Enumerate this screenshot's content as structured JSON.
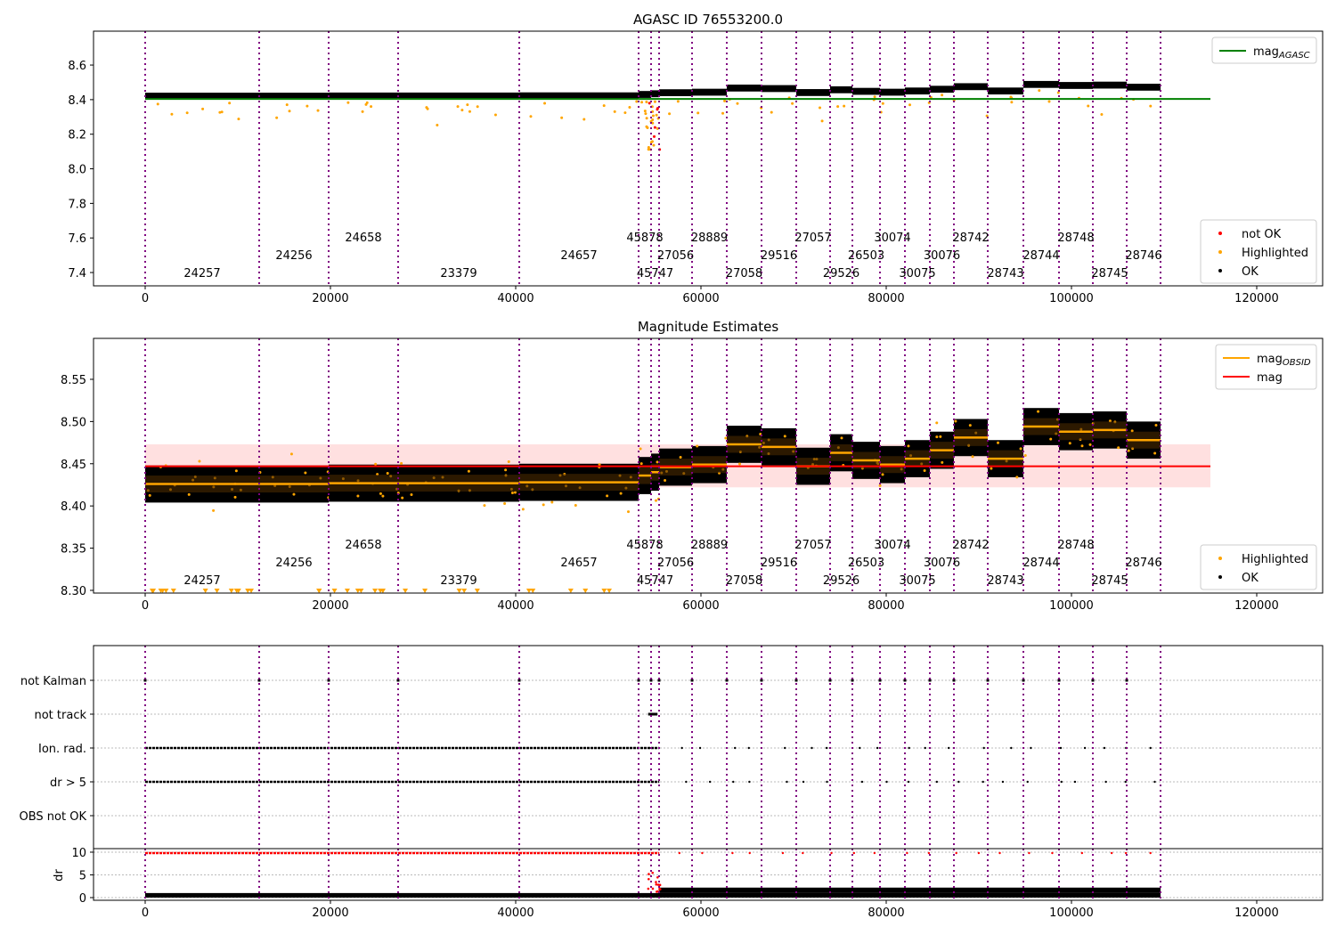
{
  "chart_data": [
    {
      "type": "scatter",
      "title": "AGASC ID 76553200.0",
      "xlim": [
        -5577,
        127115
      ],
      "ylim": [
        7.323,
        8.796
      ],
      "xticks": [
        0,
        20000,
        40000,
        60000,
        80000,
        100000,
        120000
      ],
      "yticks": [
        7.4,
        7.6,
        7.8,
        8.0,
        8.2,
        8.4,
        8.6
      ],
      "legend_upper": [
        {
          "label": "mag",
          "sub": "AGASC",
          "color": "#008000",
          "kind": "line"
        }
      ],
      "legend_lower": [
        {
          "label": "not OK",
          "color": "#ff0000",
          "kind": "dot"
        },
        {
          "label": "Highlighted",
          "color": "#ffa500",
          "kind": "dot"
        },
        {
          "label": "OK",
          "color": "#000000",
          "kind": "dot"
        }
      ],
      "mag_agasc": 8.404
    },
    {
      "type": "scatter",
      "title": "Magnitude Estimates",
      "xlim": [
        -5577,
        127115
      ],
      "ylim": [
        8.2968,
        8.5985
      ],
      "xticks": [
        0,
        20000,
        40000,
        60000,
        80000,
        100000,
        120000
      ],
      "yticks": [
        8.3,
        8.35,
        8.4,
        8.45,
        8.5,
        8.55
      ],
      "legend_upper": [
        {
          "label": "mag",
          "sub": "OBSID",
          "color": "#ffa500",
          "kind": "line"
        },
        {
          "label": "mag",
          "sub": "",
          "color": "#ff0000",
          "kind": "line"
        }
      ],
      "legend_lower": [
        {
          "label": "Highlighted",
          "color": "#ffa500",
          "kind": "dot"
        },
        {
          "label": "OK",
          "color": "#000000",
          "kind": "dot"
        }
      ],
      "mag": 8.447,
      "mag_band": [
        8.422,
        8.473
      ]
    },
    {
      "type": "scatter",
      "flag_rows": [
        "not Kalman",
        "not track",
        "Ion. rad.",
        "dr > 5",
        "OBS not OK"
      ],
      "dr_label": "dr",
      "dr_ylim": [
        -0.59,
        10.78
      ],
      "dr_yticks": [
        0,
        5,
        10
      ],
      "xticks": [
        0,
        20000,
        40000,
        60000,
        80000,
        100000,
        120000
      ]
    }
  ],
  "obsids": [
    {
      "id": "24257",
      "start": 0,
      "end": 12308,
      "mag": 8.426
    },
    {
      "id": "24256",
      "start": 12308,
      "end": 19808,
      "mag": 8.426
    },
    {
      "id": "24658",
      "start": 19808,
      "end": 27308,
      "mag": 8.427
    },
    {
      "id": "23379",
      "start": 27308,
      "end": 40385,
      "mag": 8.427
    },
    {
      "id": "24657",
      "start": 40385,
      "end": 53269,
      "mag": 8.428
    },
    {
      "id": "45878",
      "start": 53269,
      "end": 54615,
      "mag": 8.436
    },
    {
      "id": "45747",
      "start": 54615,
      "end": 55481,
      "mag": 8.44
    },
    {
      "id": "27056",
      "start": 55481,
      "end": 59038,
      "mag": 8.446
    },
    {
      "id": "28889",
      "start": 59038,
      "end": 62788,
      "mag": 8.449
    },
    {
      "id": "27058",
      "start": 62788,
      "end": 66538,
      "mag": 8.473
    },
    {
      "id": "29516",
      "start": 66538,
      "end": 70288,
      "mag": 8.47
    },
    {
      "id": "27057",
      "start": 70288,
      "end": 73942,
      "mag": 8.447
    },
    {
      "id": "29526",
      "start": 73942,
      "end": 76346,
      "mag": 8.463
    },
    {
      "id": "26503",
      "start": 76346,
      "end": 79327,
      "mag": 8.454
    },
    {
      "id": "30074",
      "start": 79327,
      "end": 82019,
      "mag": 8.449
    },
    {
      "id": "30075",
      "start": 82019,
      "end": 84712,
      "mag": 8.456
    },
    {
      "id": "30076",
      "start": 84712,
      "end": 87308,
      "mag": 8.466
    },
    {
      "id": "28742",
      "start": 87308,
      "end": 90962,
      "mag": 8.481
    },
    {
      "id": "28743",
      "start": 90962,
      "end": 94808,
      "mag": 8.456
    },
    {
      "id": "28744",
      "start": 94808,
      "end": 98654,
      "mag": 8.494
    },
    {
      "id": "28748",
      "start": 98654,
      "end": 102308,
      "mag": 8.488
    },
    {
      "id": "28745",
      "start": 102308,
      "end": 105962,
      "mag": 8.49
    },
    {
      "id": "28746",
      "start": 105962,
      "end": 109615,
      "mag": 8.478
    }
  ]
}
